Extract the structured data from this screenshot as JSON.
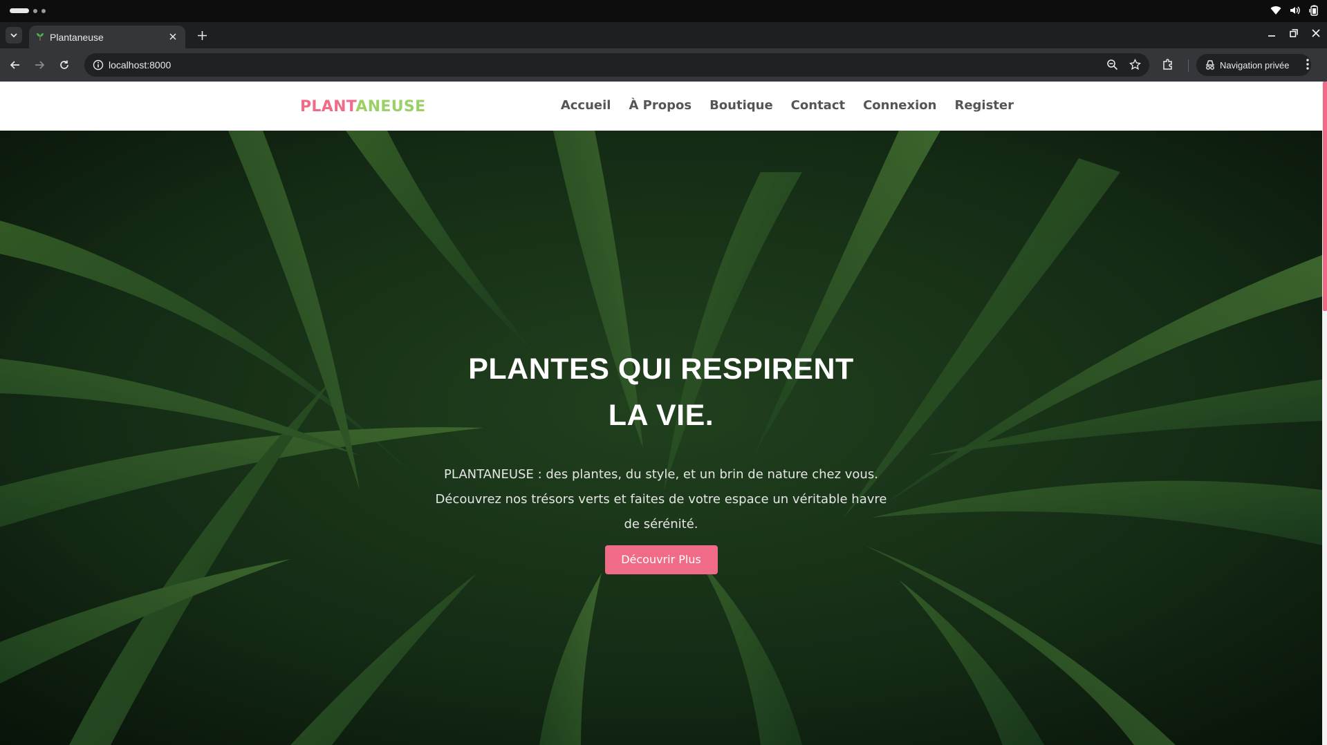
{
  "browser": {
    "tab_title": "Plantaneuse",
    "url": "localhost:8000",
    "incognito_label": "Navigation privée"
  },
  "site": {
    "logo_part1": "PLANT",
    "logo_part2": "ANEUSE",
    "logo_colors": {
      "part1": "#ef6b8a",
      "part2": "#9bd067"
    },
    "nav": [
      "Accueil",
      "À Propos",
      "Boutique",
      "Contact",
      "Connexion",
      "Register"
    ]
  },
  "hero": {
    "title_line1": "PLANTES QUI RESPIRENT",
    "title_line2": "LA VIE.",
    "text": "PLANTANEUSE : des plantes, du style, et un brin de nature chez vous. Découvrez nos trésors verts et faites de votre espace un véritable havre de sérénité.",
    "button_label": "Découvrir Plus",
    "accent_color": "#f06b87"
  },
  "icons": {
    "os": [
      "wifi-icon",
      "volume-icon",
      "battery-icon"
    ],
    "toolbar": [
      "back-icon",
      "forward-icon",
      "reload-icon",
      "info-icon",
      "zoom-icon",
      "star-icon",
      "extensions-icon",
      "incognito-icon",
      "menu-icon"
    ]
  }
}
